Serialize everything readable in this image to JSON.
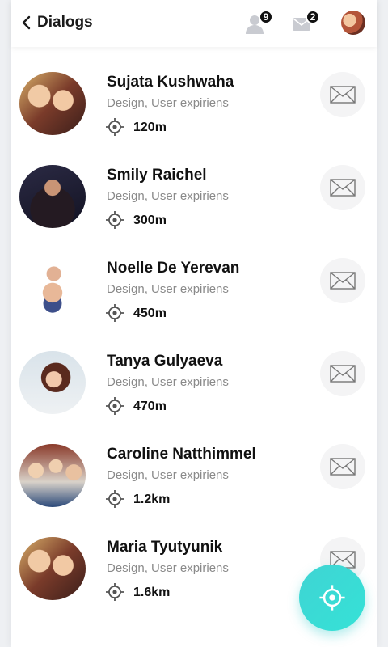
{
  "header": {
    "title": "Dialogs",
    "contacts_badge": "9",
    "messages_badge": "2"
  },
  "contacts": [
    {
      "name": "Sujata Kushwaha",
      "role": "Design, User expiriens",
      "distance": "120m"
    },
    {
      "name": "Smily Raichel",
      "role": "Design, User expiriens",
      "distance": "300m"
    },
    {
      "name": "Noelle De Yerevan",
      "role": "Design, User expiriens",
      "distance": "450m"
    },
    {
      "name": "Tanya Gulyaeva",
      "role": "Design, User expiriens",
      "distance": "470m"
    },
    {
      "name": "Caroline Natthimmel",
      "role": "Design, User expiriens",
      "distance": "1.2km"
    },
    {
      "name": "Maria Tyutyunik",
      "role": "Design, User expiriens",
      "distance": "1.6km"
    }
  ],
  "icons": {
    "back": "chevron-left-icon",
    "contacts": "user-icon",
    "messages": "envelope-icon",
    "location": "location-target-icon",
    "message_button": "envelope-outline-icon",
    "fab": "location-target-icon"
  },
  "colors": {
    "accent": "#3fd4d4",
    "text_primary": "#111111",
    "text_secondary": "#8a8a8a"
  }
}
